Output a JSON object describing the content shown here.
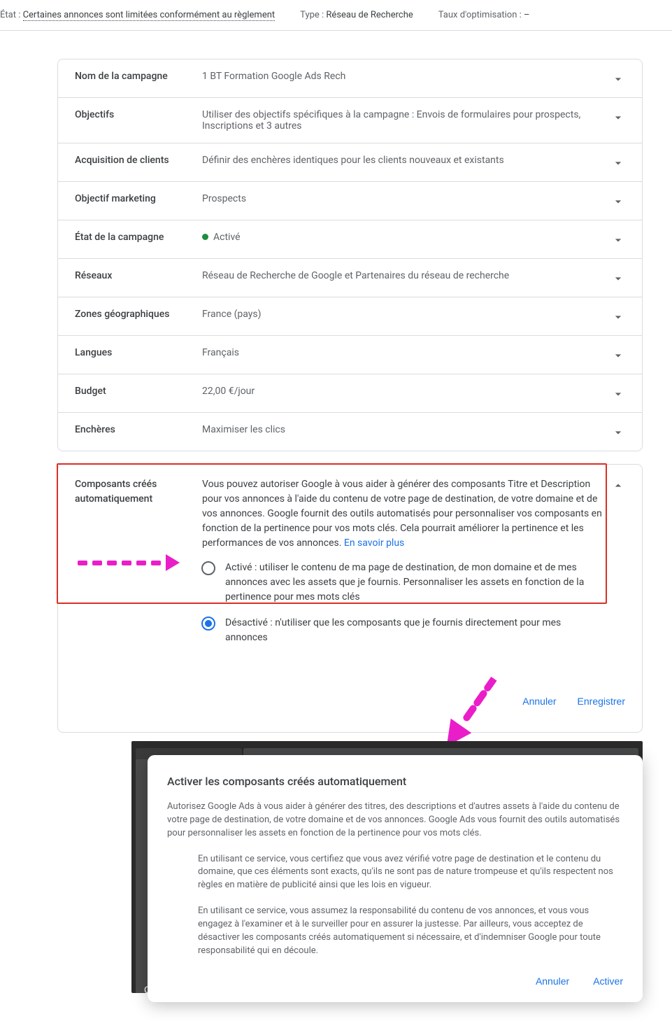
{
  "topbar": {
    "etat_label": "État :",
    "etat_value": "Certaines annonces sont limitées conformément au règlement",
    "type_label": "Type :",
    "type_value": "Réseau de Recherche",
    "opt_label": "Taux d'optimisation :",
    "opt_value": "–"
  },
  "rows": {
    "campaign_name": {
      "label": "Nom de la campagne",
      "value": "1 BT Formation Google Ads Rech"
    },
    "objectifs": {
      "label": "Objectifs",
      "value": "Utiliser des objectifs spécifiques à la campagne : Envois de formulaires pour prospects, Inscriptions et 3 autres"
    },
    "acquisition": {
      "label": "Acquisition de clients",
      "value": "Définir des enchères identiques pour les clients nouveaux et existants"
    },
    "marketing": {
      "label": "Objectif marketing",
      "value": "Prospects"
    },
    "campaign_state": {
      "label": "État de la campagne",
      "value": "Activé"
    },
    "reseaux": {
      "label": "Réseaux",
      "value": "Réseau de Recherche de Google et Partenaires du réseau de recherche"
    },
    "zones": {
      "label": "Zones géographiques",
      "value": "France (pays)"
    },
    "langues": {
      "label": "Langues",
      "value": "Français"
    },
    "budget": {
      "label": "Budget",
      "value": "22,00 €/jour"
    },
    "encheres": {
      "label": "Enchères",
      "value": "Maximiser les clics"
    }
  },
  "expanded": {
    "label": "Composants créés automatiquement",
    "desc": "Vous pouvez autoriser Google à vous aider à générer des composants Titre et Description pour vos annonces à l'aide du contenu de votre page de destination, de votre domaine et de vos annonces. Google fournit des outils automatisés pour personnaliser vos composants en fonction de la pertinence pour vos mots clés. Cela pourrait améliorer la pertinence et les performances de vos annonces. ",
    "link_text": "En savoir plus",
    "radio_on": "Activé : utiliser le contenu de ma page de destination, de mon domaine et de mes annonces avec les assets que je fournis. Personnaliser les assets en fonction de la pertinence pour mes mots clés",
    "radio_off": "Désactivé : n'utiliser que les composants que je fournis directement pour mes annonces",
    "cancel": "Annuler",
    "save": "Enregistrer"
  },
  "modal": {
    "title": "Activer les composants créés automatiquement",
    "p1": "Autorisez Google Ads à vous aider à générer des titres, des descriptions et d'autres assets à l'aide du contenu de votre page de destination, de votre domaine et de vos annonces. Google Ads vous fournit des outils automatisés pour personnaliser les assets en fonction de la pertinence pour vos mots clés.",
    "p2": "En utilisant ce service, vous certifiez que vous avez vérifié votre page de destination et le contenu du domaine, que ces éléments sont exacts, qu'ils ne sont pas de nature trompeuse et qu'ils respectent nos règles en matière de publicité ainsi que les lois en vigueur.",
    "p3": "En utilisant ce service, vous assumez la responsabilité du contenu de vos annonces, et vous vous engagez à l'examiner et à le surveiller pour en assurer la justesse. Par ailleurs, vous acceptez de désactiver les composants créés automatiquement si nécessaire, et d'indemniser Google pour toute responsabilité qui en découle.",
    "cancel": "Annuler",
    "activate": "Activer"
  },
  "bg": {
    "label": "Composants créés",
    "value": "Vous pouvez autoriser Google"
  }
}
